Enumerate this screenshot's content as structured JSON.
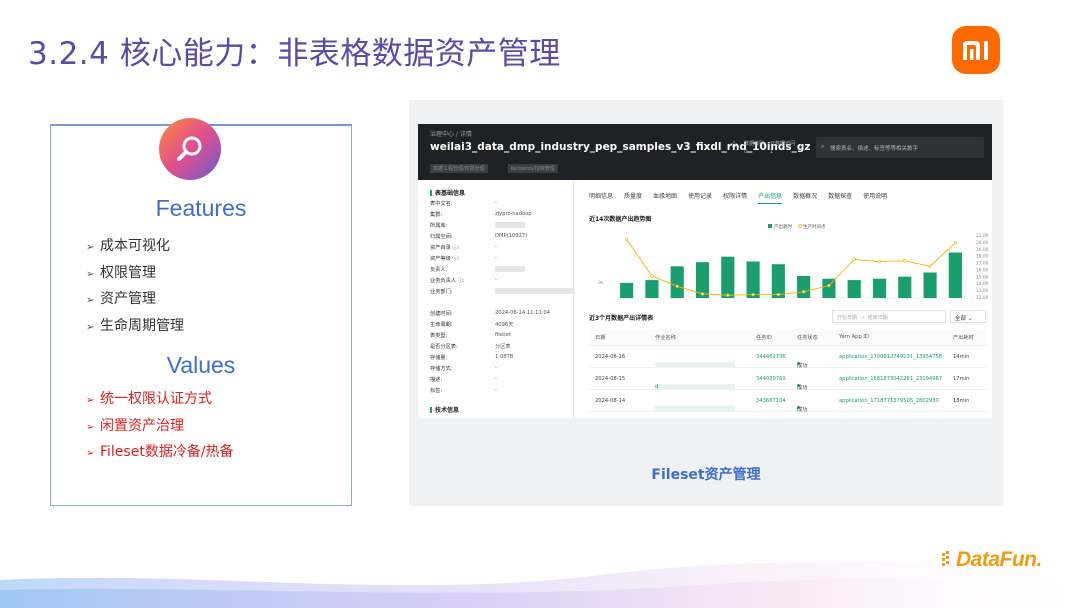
{
  "slide": {
    "title": "3.2.4 核心能力：非表格数据资产管理",
    "logo_icon": "xiaomi-logo",
    "brand": "DataFun."
  },
  "features": {
    "icon": "search-icon",
    "heading": "Features",
    "items": [
      "成本可视化",
      "权限管理",
      "资产管理",
      "生命周期管理"
    ]
  },
  "values": {
    "heading": "Values",
    "items": [
      "统一权限认证方式",
      "闲置资产治理",
      "Fileset数据冷备/热备"
    ]
  },
  "screenshot": {
    "caption": "Fileset资产管理",
    "breadcrumb": "治理中心 / 详情",
    "asset_name": "weilai3_data_dmp_industry_pep_samples_v3_fixdl_rnd_10inds_gz",
    "stats": [
      {
        "label": "数据级别",
        "value": "0"
      },
      {
        "label": "元数据访问",
        "value": "1"
      }
    ],
    "search_placeholder": "搜索表名、描述、标签等等相关数字",
    "tag_buttons": [
      "数据工程管理/权限管理",
      "Kerberos/授权管理"
    ],
    "side": {
      "basic_title": "表基础信息",
      "basic": [
        {
          "label": "表中文名:",
          "value": "-"
        },
        {
          "label": "集群:",
          "value": "zjyprc-hadoop"
        },
        {
          "label": "所属库:",
          "value": ""
        },
        {
          "label": "归属空间:",
          "value": "DMP(10927)"
        },
        {
          "label": "资产目录 ⓘ:",
          "value": "-"
        },
        {
          "label": "资产等级 ⓘ:",
          "value": "-"
        },
        {
          "label": "负责人:",
          "value": ""
        },
        {
          "label": "业务负责人 ⓘ:",
          "value": "-"
        },
        {
          "label": "业务部门:",
          "value": ""
        }
      ],
      "meta": [
        {
          "label": "创建时间:",
          "value": "2024-06-14 11:11:04"
        },
        {
          "label": "生命周期:",
          "value": "4096天"
        },
        {
          "label": "表类型:",
          "value": "fileset"
        },
        {
          "label": "是否分区表:",
          "value": "分区表"
        },
        {
          "label": "存储量:",
          "value": "1.08TB"
        },
        {
          "label": "存储方式:",
          "value": "-"
        },
        {
          "label": "描述:",
          "value": "-"
        },
        {
          "label": "标签:",
          "value": "-"
        }
      ],
      "tech_title": "技术信息"
    },
    "tabs": [
      "明细信息",
      "质量度",
      "血缘地图",
      "使用记录",
      "权限详情",
      "产出信息",
      "数据概况",
      "数据探查",
      "使用说明"
    ],
    "active_tab": "产出信息",
    "chart_title": "近14次数据产出趋势图",
    "table_title": "近3个月数据产出详情表",
    "date_start_placeholder": "开始日期",
    "date_end_placeholder": "结束日期",
    "select_value": "全部",
    "table": {
      "headers": [
        "日期",
        "作业名称",
        "任务ID",
        "任务状态",
        "Yarn App ID",
        "产出耗时"
      ],
      "rows": [
        {
          "date": "2024-08-16",
          "job": "",
          "task_id": "344462736",
          "status": "成功",
          "app_id": "application_1700812749231_13954758",
          "duration": "14min"
        },
        {
          "date": "2024-08-15",
          "job": "d",
          "task_id": "344039760",
          "status": "成功",
          "app_id": "application_1681873042291_23194987",
          "duration": "17min"
        },
        {
          "date": "2024-08-14",
          "job": "",
          "task_id": "343667104",
          "status": "成功",
          "app_id": "application_1718771379505_2802930",
          "duration": "18min"
        }
      ]
    }
  },
  "chart_data": {
    "type": "bar",
    "title": "近14次数据产出趋势图",
    "series": [
      {
        "name": "产出耗时",
        "type": "bar",
        "color": "#1a9e6e",
        "values": [
          14.2,
          14.6,
          16.6,
          17.2,
          18.0,
          17.3,
          16.9,
          15.2,
          14.8,
          14.6,
          14.8,
          15.1,
          15.7,
          18.6
        ]
      },
      {
        "name": "生产时间点",
        "type": "line",
        "color": "#f5b400",
        "values": [
          20.5,
          15.2,
          13.7,
          12.6,
          12.4,
          12.5,
          12.5,
          12.9,
          13.8,
          17.6,
          17.3,
          17.4,
          16.6,
          20.0
        ]
      }
    ],
    "y_ticks": [
      "21.00",
      "20.00",
      "19.00",
      "18.00",
      "17.00",
      "16.00",
      "15.00",
      "14.00",
      "13.00",
      "12.00"
    ],
    "left_tick": "0k",
    "ylim": [
      12,
      21
    ]
  }
}
